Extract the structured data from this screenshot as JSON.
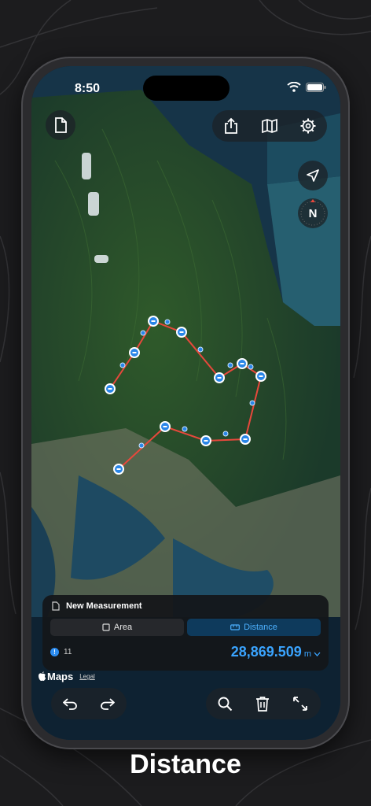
{
  "status_bar": {
    "time": "8:50"
  },
  "top_toolbar": {
    "icons": [
      "share-icon",
      "map-icon",
      "settings-icon"
    ]
  },
  "map_controls": {
    "compass_label": "N"
  },
  "measurement_panel": {
    "title": "New Measurement",
    "mode_area_label": "Area",
    "mode_distance_label": "Distance",
    "selected_mode": "Distance",
    "point_count": "11",
    "distance_value": "28,869.509",
    "distance_unit": "m"
  },
  "attribution": {
    "maps_label": "Maps",
    "legal_label": "Legal"
  },
  "caption": "Distance",
  "colors": {
    "accent": "#3aa4ff",
    "route_line": "#e8483c",
    "panel_bg": "#14161a"
  }
}
